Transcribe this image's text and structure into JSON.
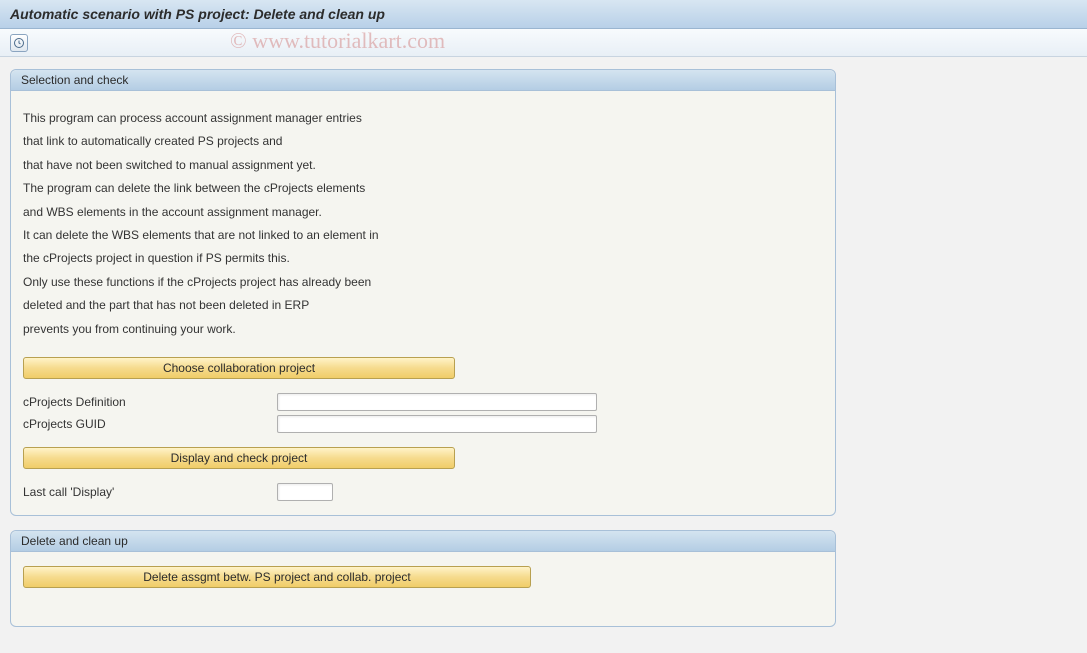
{
  "title": "Automatic scenario with PS project: Delete and clean up",
  "watermark": "© www.tutorialkart.com",
  "group1": {
    "header": "Selection and check",
    "description_lines": [
      "This program can process account assignment manager entries",
      "that link to automatically created PS projects and",
      "that have not been switched to manual assignment yet.",
      "The program can delete the link between the cProjects elements",
      "and WBS elements in the account assignment manager.",
      "It can delete the WBS elements that are not linked to an element in",
      "the cProjects project in question if PS permits this.",
      "Only use these functions if the cProjects project has already been",
      "deleted and the part that has not been deleted in ERP",
      "prevents you from continuing your work."
    ],
    "button_choose": "Choose collaboration project",
    "field_defn_label": "cProjects Definition",
    "field_defn_value": "",
    "field_guid_label": "cProjects GUID",
    "field_guid_value": "",
    "button_display": "Display and check project",
    "field_lastcall_label": "Last call 'Display'",
    "field_lastcall_value": ""
  },
  "group2": {
    "header": "Delete and clean up",
    "button_delete": "Delete assgmt betw. PS project and collab. project"
  }
}
